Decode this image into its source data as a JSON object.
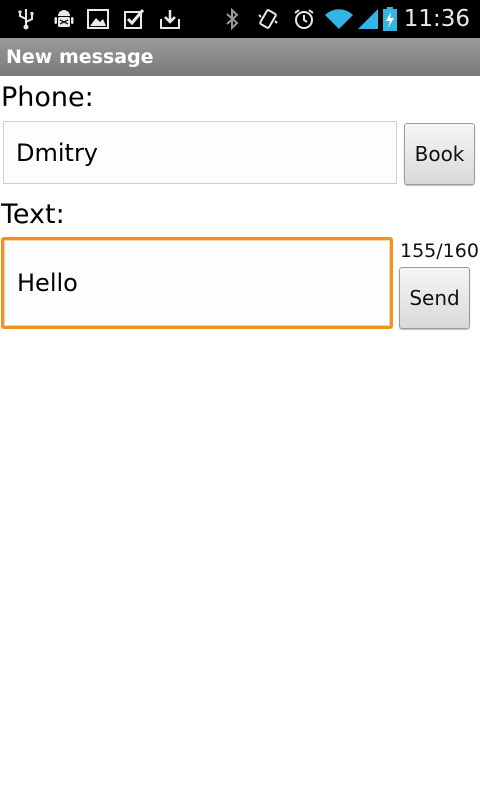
{
  "status_bar": {
    "time": "11:36",
    "icons": [
      "usb-icon",
      "android-debug-icon",
      "image-icon",
      "checkbox-icon",
      "download-icon",
      "bluetooth-icon",
      "vibrate-icon",
      "alarm-icon",
      "wifi-icon",
      "signal-icon",
      "battery-charging-icon"
    ],
    "icon_color": "#e8e8e8",
    "accent_color": "#33b5e5"
  },
  "title_bar": {
    "title": "New message"
  },
  "form": {
    "phone_label": "Phone:",
    "phone_value": "Dmitry",
    "book_button": "Book",
    "text_label": "Text:",
    "text_value": "Hello",
    "char_counter": "155/160",
    "send_button": "Send",
    "focus_color": "#f2911d"
  }
}
